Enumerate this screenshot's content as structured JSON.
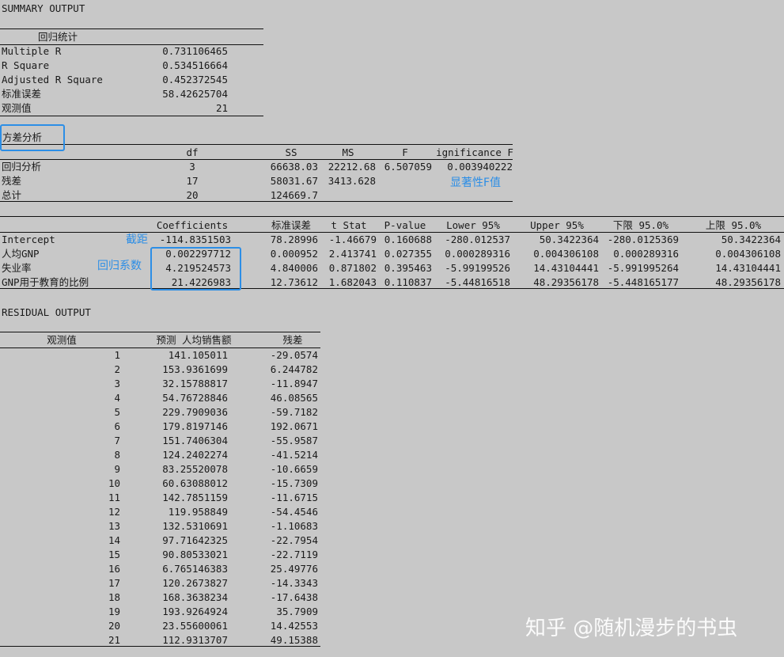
{
  "summary_title": "SUMMARY OUTPUT",
  "regression_stats": {
    "header": "回归统计",
    "rows": [
      {
        "label": "Multiple R",
        "value": "0.731106465"
      },
      {
        "label": "R Square",
        "value": "0.534516664"
      },
      {
        "label": "Adjusted R Square",
        "value": "0.452372545"
      },
      {
        "label": "标准误差",
        "value": "58.42625704"
      },
      {
        "label": "观测值",
        "value": "21"
      }
    ]
  },
  "anova": {
    "title": "方差分析",
    "headers": [
      "",
      "df",
      "SS",
      "MS",
      "F",
      "ignificance F"
    ],
    "rows": [
      [
        "回归分析",
        "3",
        "66638.03",
        "22212.68",
        "6.507059",
        "0.003940222"
      ],
      [
        "残差",
        "17",
        "58031.67",
        "3413.628",
        "",
        ""
      ],
      [
        "总计",
        "20",
        "124669.7",
        "",
        "",
        ""
      ]
    ]
  },
  "coefficients": {
    "headers": [
      "",
      "Coefficients",
      "标准误差",
      "t Stat",
      "P-value",
      "Lower 95%",
      "Upper 95%",
      "下限 95.0%",
      "上限 95.0%"
    ],
    "rows": [
      [
        "Intercept",
        "-114.8351503",
        "78.28996",
        "-1.46679",
        "0.160688",
        "-280.012537",
        "50.3422364",
        "-280.0125369",
        "50.3422364"
      ],
      [
        "人均GNP",
        "0.002297712",
        "0.000952",
        "2.413741",
        "0.027355",
        "0.000289316",
        "0.004306108",
        "0.000289316",
        "0.004306108"
      ],
      [
        "失业率",
        "4.219524573",
        "4.840006",
        "0.871802",
        "0.395463",
        "-5.99199526",
        "14.43104441",
        "-5.991995264",
        "14.43104441"
      ],
      [
        "GNP用于教育的比例",
        "21.4226983",
        "12.73612",
        "1.682043",
        "0.110837",
        "-5.44816518",
        "48.29356178",
        "-5.448165177",
        "48.29356178"
      ]
    ]
  },
  "residual": {
    "title": "RESIDUAL OUTPUT",
    "headers": [
      "观测值",
      "预测 人均销售额",
      "残差"
    ],
    "rows": [
      [
        "1",
        "141.105011",
        "-29.0574"
      ],
      [
        "2",
        "153.9361699",
        "6.244782"
      ],
      [
        "3",
        "32.15788817",
        "-11.8947"
      ],
      [
        "4",
        "54.76728846",
        "46.08565"
      ],
      [
        "5",
        "229.7909036",
        "-59.7182"
      ],
      [
        "6",
        "179.8197146",
        "192.0671"
      ],
      [
        "7",
        "151.7406304",
        "-55.9587"
      ],
      [
        "8",
        "124.2402274",
        "-41.5214"
      ],
      [
        "9",
        "83.25520078",
        "-10.6659"
      ],
      [
        "10",
        "60.63088012",
        "-15.7309"
      ],
      [
        "11",
        "142.7851159",
        "-11.6715"
      ],
      [
        "12",
        "119.958849",
        "-54.4546"
      ],
      [
        "13",
        "132.5310691",
        "-1.10683"
      ],
      [
        "14",
        "97.71642325",
        "-22.7954"
      ],
      [
        "15",
        "90.80533021",
        "-22.7119"
      ],
      [
        "16",
        "6.765146383",
        "25.49776"
      ],
      [
        "17",
        "120.2673827",
        "-14.3343"
      ],
      [
        "18",
        "168.3638234",
        "-17.6438"
      ],
      [
        "19",
        "193.9264924",
        "35.7909"
      ],
      [
        "20",
        "23.55600061",
        "14.42553"
      ],
      [
        "21",
        "112.9313707",
        "49.15388"
      ]
    ]
  },
  "annotations": {
    "significance_f": "显著性F值",
    "intercept": "截距",
    "regression_coef": "回归系数",
    "color": "#2c8ee6"
  },
  "watermark": "知乎 @随机漫步的书虫"
}
